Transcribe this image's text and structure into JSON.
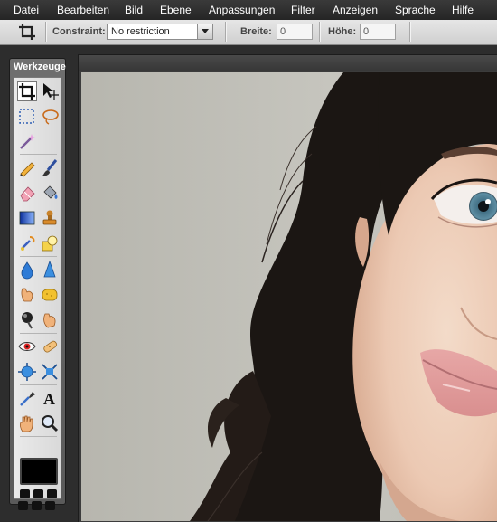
{
  "menubar": {
    "items": [
      "Datei",
      "Bearbeiten",
      "Bild",
      "Ebene",
      "Anpassungen",
      "Filter",
      "Anzeigen",
      "Sprache",
      "Hilfe"
    ]
  },
  "options": {
    "constraint_label": "Constraint:",
    "constraint_value": "No restriction",
    "width_label": "Breite:",
    "width_value": "0",
    "height_label": "Höhe:",
    "height_value": "0"
  },
  "toolbox": {
    "title": "Werkzeuge",
    "tools": [
      "crop-icon",
      "move-icon",
      "marquee-select-icon",
      "lasso-icon",
      "magic-wand-icon",
      "pencil-icon",
      "brush-icon",
      "eraser-icon",
      "paint-bucket-icon",
      "gradient-icon",
      "clone-stamp-icon",
      "color-replace-icon",
      "drawing-shape-icon",
      "blur-icon",
      "sharpen-icon",
      "smudge-icon",
      "sponge-icon",
      "burn-icon",
      "dodge-icon",
      "red-eye-icon",
      "spot-heal-icon",
      "bloat-icon",
      "pinch-icon",
      "color-picker-icon",
      "text-icon",
      "hand-icon",
      "zoom-icon"
    ],
    "primary_color": "#000000"
  },
  "colors": {
    "menubar": "#2b2b2b",
    "photo_background": "#bdbcb5"
  }
}
